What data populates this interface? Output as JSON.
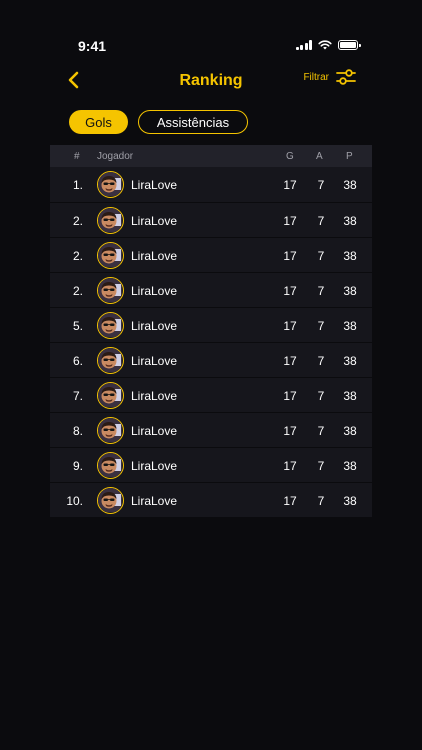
{
  "status_bar": {
    "time": "9:41"
  },
  "header": {
    "title": "Ranking",
    "filter_label": "Filtrar"
  },
  "tabs": [
    {
      "label": "Gols",
      "active": true
    },
    {
      "label": "Assistências",
      "active": false
    }
  ],
  "table": {
    "columns": {
      "rank": "#",
      "player": "Jogador",
      "g": "G",
      "a": "A",
      "p": "P"
    },
    "rows": [
      {
        "rank": "1.",
        "player": "LiraLove",
        "g": "17",
        "a": "7",
        "p": "38"
      },
      {
        "rank": "2.",
        "player": "LiraLove",
        "g": "17",
        "a": "7",
        "p": "38"
      },
      {
        "rank": "2.",
        "player": "LiraLove",
        "g": "17",
        "a": "7",
        "p": "38"
      },
      {
        "rank": "2.",
        "player": "LiraLove",
        "g": "17",
        "a": "7",
        "p": "38"
      },
      {
        "rank": "5.",
        "player": "LiraLove",
        "g": "17",
        "a": "7",
        "p": "38"
      },
      {
        "rank": "6.",
        "player": "LiraLove",
        "g": "17",
        "a": "7",
        "p": "38"
      },
      {
        "rank": "7.",
        "player": "LiraLove",
        "g": "17",
        "a": "7",
        "p": "38"
      },
      {
        "rank": "8.",
        "player": "LiraLove",
        "g": "17",
        "a": "7",
        "p": "38"
      },
      {
        "rank": "9.",
        "player": "LiraLove",
        "g": "17",
        "a": "7",
        "p": "38"
      },
      {
        "rank": "10.",
        "player": "LiraLove",
        "g": "17",
        "a": "7",
        "p": "38"
      }
    ]
  },
  "icons": {
    "back": "chevron-left-icon",
    "filter": "sliders-icon",
    "signal": "signal-icon",
    "wifi": "wifi-icon",
    "battery": "battery-icon",
    "avatar": "avatar-photo"
  },
  "colors": {
    "accent": "#f5c400",
    "background": "#0b0b0e",
    "row": "#16161c",
    "header_row": "#22222a"
  }
}
